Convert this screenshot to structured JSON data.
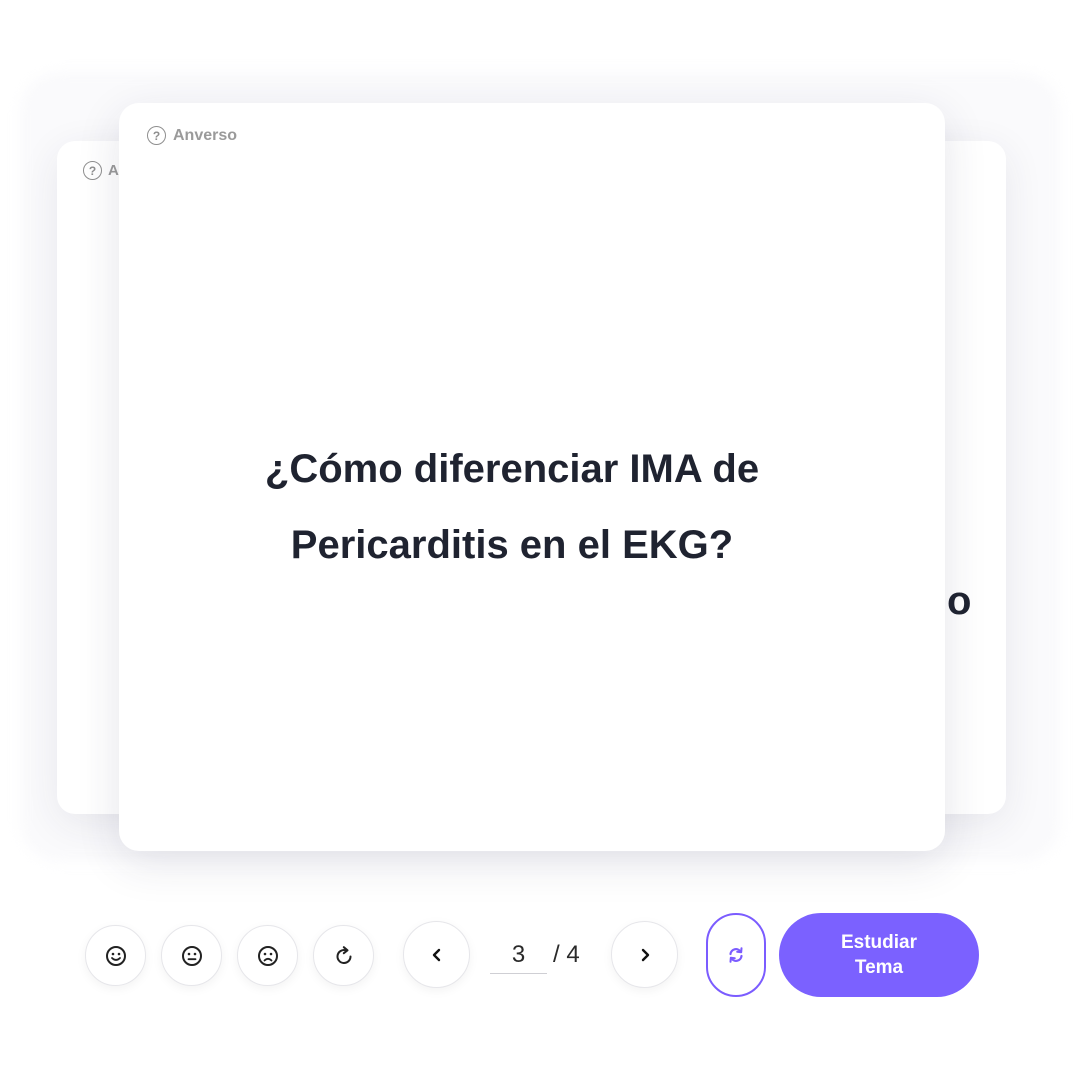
{
  "card_stack": {
    "back_card": {
      "side_label": "A",
      "peek_text": "o"
    },
    "front_card": {
      "side_label": "Anverso",
      "question": "¿Cómo diferenciar IMA de Pericarditis en el EKG?"
    }
  },
  "controls": {
    "rating_icons": [
      "smile-face-icon",
      "neutral-face-icon",
      "sad-face-icon",
      "restart-icon"
    ],
    "prev_icon": "chevron-left-icon",
    "next_icon": "chevron-right-icon",
    "current_page": "3",
    "page_separator": "/ 4",
    "refresh_icon": "sync-icon",
    "study_button_label": "Estudiar Tema",
    "accent_color": "#7b61ff"
  }
}
